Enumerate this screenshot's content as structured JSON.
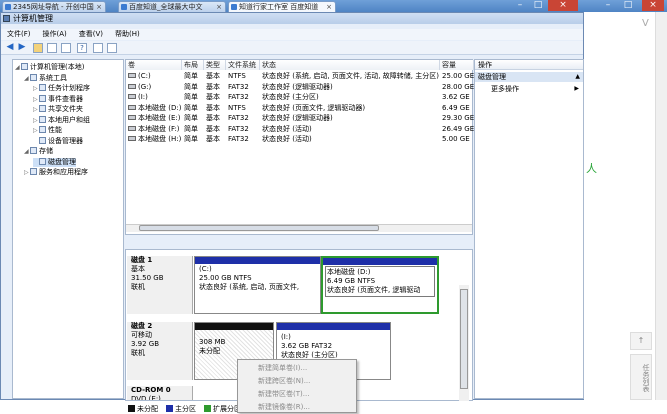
{
  "browser": {
    "tabs": [
      {
        "label": "2345网址导航 - 开创中国"
      },
      {
        "label": "百度知道_全球最大中文"
      },
      {
        "label": "知道行家工作室 百度知道"
      }
    ],
    "min_glyph": "–",
    "max_glyph": "□",
    "close_glyph": "×",
    "side_green_text": "人",
    "side_green_text2": "V",
    "side_button_up": "↑",
    "side_button_label": "任务列表"
  },
  "window": {
    "title": "计算机管理",
    "menu": [
      "文件(F)",
      "操作(A)",
      "查看(V)",
      "帮助(H)"
    ],
    "toolbar_icons": [
      "back-icon",
      "forward-icon",
      "up-folder-icon",
      "show-hide-tree-icon",
      "properties-icon",
      "help-icon",
      "export-icon",
      "refresh-icon"
    ]
  },
  "tree": {
    "items": [
      {
        "label": "计算机管理(本地)",
        "indent": 0,
        "twisty": "◢"
      },
      {
        "label": "系统工具",
        "indent": 1,
        "twisty": "◢"
      },
      {
        "label": "任务计划程序",
        "indent": 2,
        "twisty": "▷"
      },
      {
        "label": "事件查看器",
        "indent": 2,
        "twisty": "▷"
      },
      {
        "label": "共享文件夹",
        "indent": 2,
        "twisty": "▷"
      },
      {
        "label": "本地用户和组",
        "indent": 2,
        "twisty": "▷"
      },
      {
        "label": "性能",
        "indent": 2,
        "twisty": "▷"
      },
      {
        "label": "设备管理器",
        "indent": 2,
        "twisty": ""
      },
      {
        "label": "存储",
        "indent": 1,
        "twisty": "◢"
      },
      {
        "label": "磁盘管理",
        "indent": 2,
        "twisty": "",
        "selected": true
      },
      {
        "label": "服务和应用程序",
        "indent": 1,
        "twisty": "▷"
      }
    ]
  },
  "volumes": {
    "columns": [
      "卷",
      "布局",
      "类型",
      "文件系统",
      "状态",
      "容量"
    ],
    "rows": [
      {
        "vol": "(C:)",
        "layout": "简单",
        "type": "基本",
        "fs": "NTFS",
        "status": "状态良好 (系统, 启动, 页面文件, 活动, 故障转储, 主分区)",
        "cap": "25.00 GE"
      },
      {
        "vol": "(G:)",
        "layout": "简单",
        "type": "基本",
        "fs": "FAT32",
        "status": "状态良好 (逻辑驱动器)",
        "cap": "28.00 GE"
      },
      {
        "vol": "(I:)",
        "layout": "简单",
        "type": "基本",
        "fs": "FAT32",
        "status": "状态良好 (主分区)",
        "cap": "3.62 GE"
      },
      {
        "vol": "本地磁盘 (D:)",
        "layout": "简单",
        "type": "基本",
        "fs": "NTFS",
        "status": "状态良好 (页面文件, 逻辑驱动器)",
        "cap": "6.49 GE"
      },
      {
        "vol": "本地磁盘 (E:)",
        "layout": "简单",
        "type": "基本",
        "fs": "FAT32",
        "status": "状态良好 (逻辑驱动器)",
        "cap": "29.30 GE"
      },
      {
        "vol": "本地磁盘 (F:)",
        "layout": "简单",
        "type": "基本",
        "fs": "FAT32",
        "status": "状态良好 (活动)",
        "cap": "26.49 GE"
      },
      {
        "vol": "本地磁盘 (H:)",
        "layout": "简单",
        "type": "基本",
        "fs": "FAT32",
        "status": "状态良好 (活动)",
        "cap": "5.00 GE"
      }
    ]
  },
  "disks": {
    "disk1": {
      "name": "磁盘 1",
      "type": "基本",
      "size": "31.50 GB",
      "status": "联机",
      "parts": [
        {
          "name": "(C:)",
          "size": "25.00 GB NTFS",
          "status": "状态良好 (系统, 启动, 页面文件,"
        },
        {
          "name": "本地磁盘 (D:)",
          "size": "6.49 GB NTFS",
          "status": "状态良好 (页面文件, 逻辑驱动"
        }
      ]
    },
    "disk2": {
      "name": "磁盘 2",
      "type": "可移动",
      "size": "3.92 GB",
      "status": "联机",
      "parts": [
        {
          "name": "",
          "size": "308 MB",
          "status": "未分配"
        },
        {
          "name": "(I:)",
          "size": "3.62 GB FAT32",
          "status": "状态良好 (主分区)"
        }
      ]
    },
    "cdrom": {
      "name": "CD-ROM 0",
      "type": "DVD (E:)"
    }
  },
  "legend": [
    {
      "label": "未分配",
      "color": "#111111"
    },
    {
      "label": "主分区",
      "color": "#1e2fa8"
    },
    {
      "label": "扩展分区",
      "color": "#2e9a2e"
    }
  ],
  "actions": {
    "header": "操作",
    "section": "磁盘管理",
    "more": "更多操作",
    "more_arrow": "▶",
    "section_arrow": "▲"
  },
  "context_menu": {
    "items": [
      "新建简单卷(I)...",
      "新建跨区卷(N)...",
      "新建带区卷(T)...",
      "新建镜像卷(R)..."
    ]
  }
}
